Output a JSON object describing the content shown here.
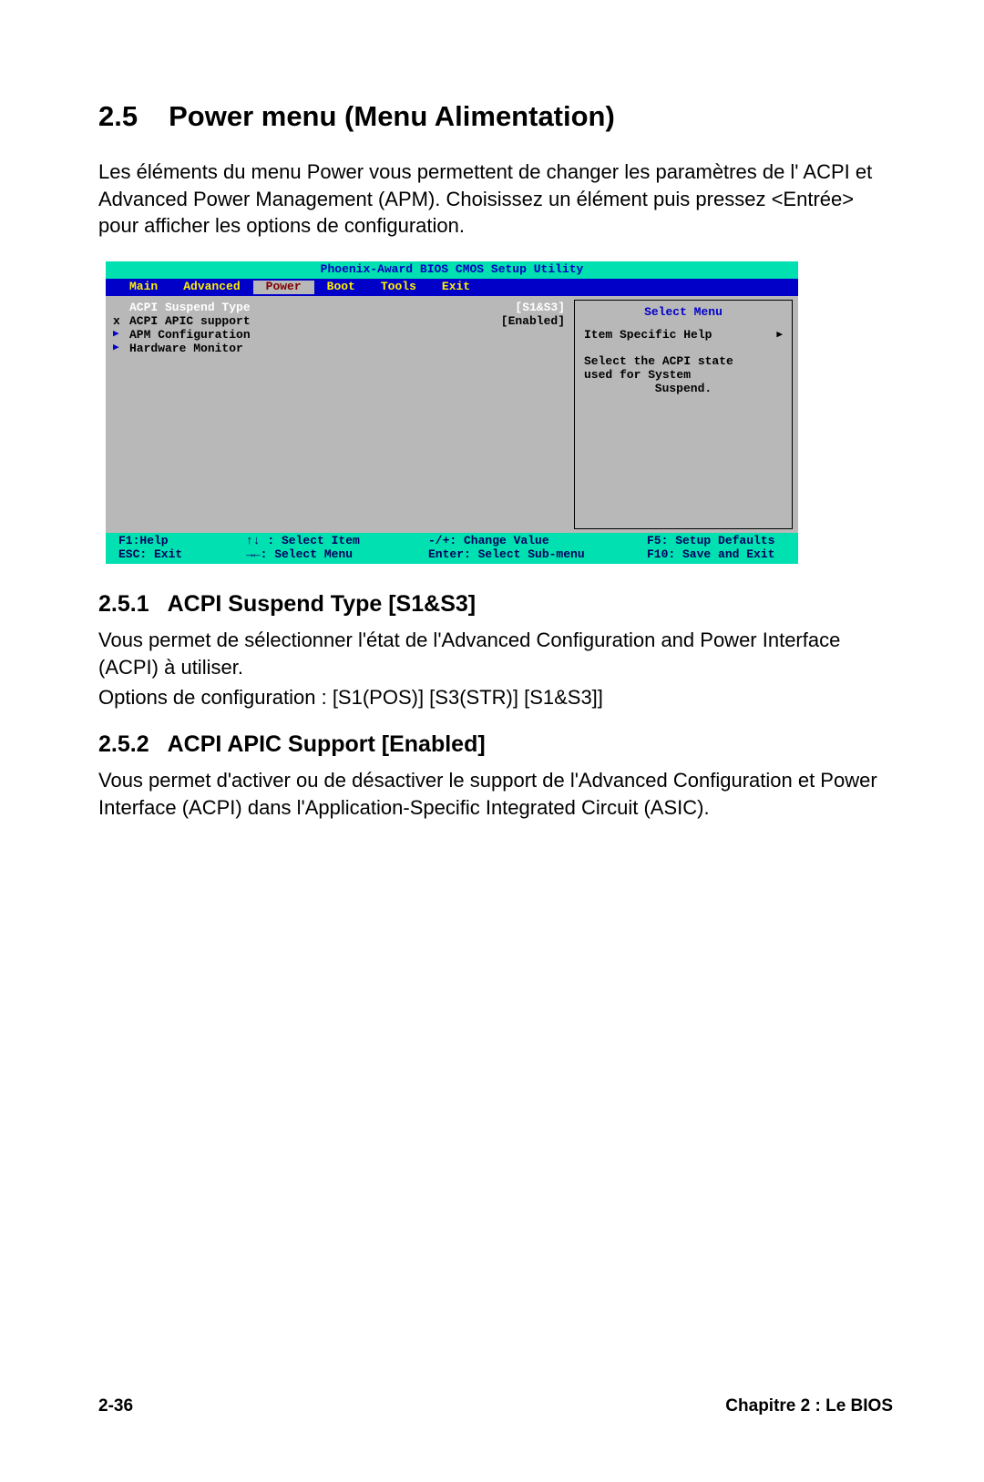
{
  "heading": {
    "number": "2.5",
    "title": "Power menu (Menu Alimentation)"
  },
  "intro": "Les éléments du menu Power vous permettent de changer les paramètres de l' ACPI et Advanced Power Management (APM). Choisissez un élément puis pressez <Entrée> pour afficher les options de configuration.",
  "bios": {
    "title": "Phoenix-Award BIOS CMOS Setup Utility",
    "menu": [
      "Main",
      "Advanced",
      "Power",
      "Boot",
      "Tools",
      "Exit"
    ],
    "active_menu": "Power",
    "items": [
      {
        "mark": "",
        "label": "ACPI Suspend Type",
        "value": "[S1&S3]",
        "highlight": true
      },
      {
        "mark": "x",
        "label": "ACPI APIC support",
        "value": "[Enabled]",
        "highlight": false
      },
      {
        "mark": "▶",
        "label": "APM Configuration",
        "value": "",
        "highlight": false
      },
      {
        "mark": "▶",
        "label": "Hardware Monitor",
        "value": "",
        "highlight": false
      }
    ],
    "help": {
      "title": "Select Menu",
      "line1": "Item Specific Help",
      "body1": "Select the ACPI state",
      "body2": "used for System",
      "body3": "Suspend."
    },
    "footer": {
      "c1a": "F1:Help",
      "c2a": "↑↓ : Select Item",
      "c3a": "-/+: Change Value",
      "c4a": "F5: Setup Defaults",
      "c1b": "ESC: Exit",
      "c2b": "→←: Select Menu",
      "c3b": "Enter: Select Sub-menu",
      "c4b": "F10: Save and Exit"
    }
  },
  "s251": {
    "number": "2.5.1",
    "title": "ACPI Suspend Type [S1&S3]",
    "p1": "Vous permet de sélectionner l'état de l'Advanced Configuration and Power Interface (ACPI) à utiliser.",
    "p2": "Options de configuration : [S1(POS)] [S3(STR)] [S1&S3]]"
  },
  "s252": {
    "number": "2.5.2",
    "title": "ACPI APIC Support [Enabled]",
    "p1": "Vous permet d'activer ou de désactiver le support de l'Advanced Configuration et Power Interface (ACPI) dans l'Application-Specific Integrated Circuit (ASIC)."
  },
  "footer": {
    "left": "2-36",
    "right": "Chapitre 2 : Le BIOS"
  }
}
